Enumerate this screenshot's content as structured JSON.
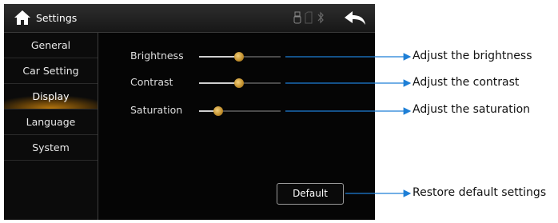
{
  "header": {
    "title": "Settings",
    "home_icon": "home-icon",
    "back_icon": "back-arrow-icon"
  },
  "status_icons": [
    "usb-icon",
    "sd-card-icon",
    "bluetooth-icon"
  ],
  "sidebar": {
    "items": [
      {
        "label": "General",
        "active": false
      },
      {
        "label": "Car Setting",
        "active": false
      },
      {
        "label": "Display",
        "active": true
      },
      {
        "label": "Language",
        "active": false
      },
      {
        "label": "System",
        "active": false
      }
    ]
  },
  "display": {
    "brightness": {
      "label": "Brightness",
      "level": 0.49
    },
    "contrast": {
      "label": "Contrast",
      "level": 0.49
    },
    "saturation": {
      "label": "Saturation",
      "level": 0.24
    },
    "default_button": "Default"
  },
  "annotations": {
    "brightness": "Adjust the brightness",
    "contrast": "Adjust the contrast",
    "saturation": "Adjust the saturation",
    "default": "Restore default settings"
  },
  "colors": {
    "accent": "#c08e2c",
    "active_glow": "#b8780e",
    "background": "#050505",
    "arrow": "#1e7fd6"
  }
}
